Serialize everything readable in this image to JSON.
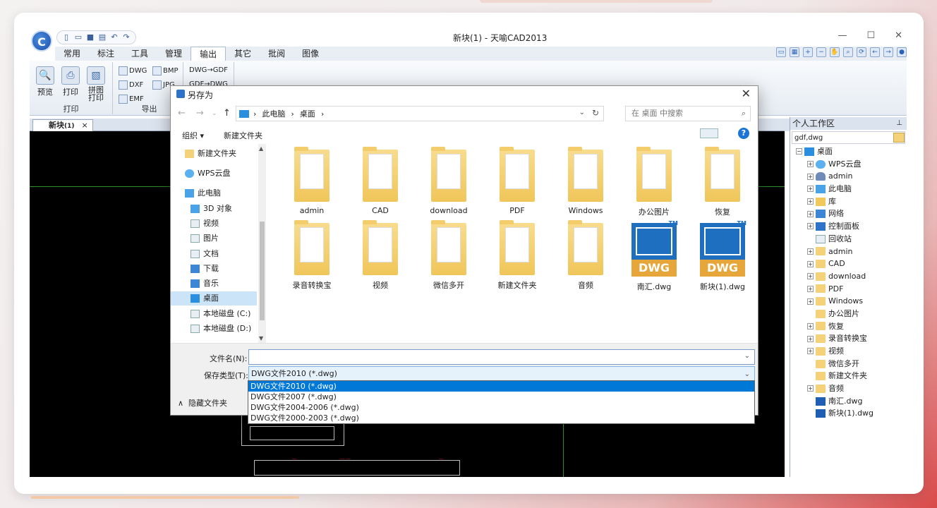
{
  "app": {
    "title": "新块(1) - 天喻CAD2013",
    "logo_letter": "C"
  },
  "menu": [
    "常用",
    "标注",
    "工具",
    "管理",
    "输出",
    "其它",
    "批阅",
    "图像"
  ],
  "active_menu": "输出",
  "ribbon": {
    "print_group": {
      "label": "打印",
      "buttons": [
        "预览",
        "打印",
        "拼图\n打印"
      ]
    },
    "export_group": {
      "label": "导出",
      "items": [
        "DWG",
        "BMP",
        "DXF",
        "JPG",
        "EMF"
      ]
    },
    "convert_group": {
      "items": [
        "DWG→GDF",
        "GDF→DWG"
      ]
    }
  },
  "doc_tab": {
    "name": "新块",
    "suffix": "(1)",
    "close": "×"
  },
  "panel": {
    "title": "个人工作区",
    "pin": "⊥",
    "search": "gdf,dwg",
    "tree": [
      {
        "label": "桌面",
        "icon": "desk",
        "level": 0,
        "expander": "−"
      },
      {
        "label": "WPS云盘",
        "icon": "cloud",
        "level": 1,
        "expander": "+"
      },
      {
        "label": "admin",
        "icon": "user",
        "level": 1,
        "expander": "+"
      },
      {
        "label": "此电脑",
        "icon": "pc",
        "level": 1,
        "expander": "+"
      },
      {
        "label": "库",
        "icon": "lib",
        "level": 1,
        "expander": "+"
      },
      {
        "label": "网络",
        "icon": "net",
        "level": 1,
        "expander": "+"
      },
      {
        "label": "控制面板",
        "icon": "cp",
        "level": 1,
        "expander": "+"
      },
      {
        "label": "回收站",
        "icon": "bin",
        "level": 1,
        "expander": ""
      },
      {
        "label": "admin",
        "icon": "f",
        "level": 1,
        "expander": "+"
      },
      {
        "label": "CAD",
        "icon": "f",
        "level": 1,
        "expander": "+"
      },
      {
        "label": "download",
        "icon": "f",
        "level": 1,
        "expander": "+"
      },
      {
        "label": "PDF",
        "icon": "f",
        "level": 1,
        "expander": "+"
      },
      {
        "label": "Windows",
        "icon": "f",
        "level": 1,
        "expander": "+"
      },
      {
        "label": "办公图片",
        "icon": "f",
        "level": 1,
        "expander": ""
      },
      {
        "label": "恢复",
        "icon": "f",
        "level": 1,
        "expander": "+"
      },
      {
        "label": "录音转换宝",
        "icon": "f",
        "level": 1,
        "expander": "+"
      },
      {
        "label": "视频",
        "icon": "f",
        "level": 1,
        "expander": "+"
      },
      {
        "label": "微信多开",
        "icon": "f",
        "level": 1,
        "expander": ""
      },
      {
        "label": "新建文件夹",
        "icon": "f",
        "level": 1,
        "expander": ""
      },
      {
        "label": "音频",
        "icon": "f",
        "level": 1,
        "expander": "+"
      },
      {
        "label": "南汇.dwg",
        "icon": "dwgi",
        "level": 1,
        "expander": ""
      },
      {
        "label": "新块(1).dwg",
        "icon": "dwgi",
        "level": 1,
        "expander": ""
      }
    ]
  },
  "dialog": {
    "title": "另存为",
    "close": "✕",
    "breadcrumb": [
      "此电脑",
      "桌面"
    ],
    "search_placeholder": "在 桌面 中搜索",
    "organize": "组织 ▾",
    "new_folder": "新建文件夹",
    "help": "?",
    "nav_items": [
      {
        "label": "新建文件夹",
        "icon": "f"
      },
      {
        "label": "WPS云盘",
        "icon": "cloud"
      },
      {
        "label": "此电脑",
        "icon": "pc"
      },
      {
        "label": "3D 对象",
        "icon": "pc"
      },
      {
        "label": "视频",
        "icon": "bin"
      },
      {
        "label": "图片",
        "icon": "bin"
      },
      {
        "label": "文档",
        "icon": "bin"
      },
      {
        "label": "下载",
        "icon": "net"
      },
      {
        "label": "音乐",
        "icon": "net"
      },
      {
        "label": "桌面",
        "icon": "desk"
      },
      {
        "label": "本地磁盘 (C:)",
        "icon": "bin"
      },
      {
        "label": "本地磁盘 (D:)",
        "icon": "bin"
      }
    ],
    "selected_nav": "桌面",
    "files": [
      {
        "name": "admin",
        "type": "folder"
      },
      {
        "name": "CAD",
        "type": "folder"
      },
      {
        "name": "download",
        "type": "folder"
      },
      {
        "name": "PDF",
        "type": "folder"
      },
      {
        "name": "Windows",
        "type": "folder"
      },
      {
        "name": "办公图片",
        "type": "folder"
      },
      {
        "name": "恢复",
        "type": "folder"
      },
      {
        "name": "录音转换宝",
        "type": "folder"
      },
      {
        "name": "视频",
        "type": "folder"
      },
      {
        "name": "微信多开",
        "type": "folder"
      },
      {
        "name": "新建文件夹",
        "type": "folder"
      },
      {
        "name": "音频",
        "type": "folder"
      },
      {
        "name": "南汇.dwg",
        "type": "dwg"
      },
      {
        "name": "新块(1).dwg",
        "type": "dwg"
      }
    ],
    "dwg_label": "DWG",
    "dwg_tm": "TM",
    "filename_label": "文件名(N):",
    "filename_value": "",
    "filetype_label": "保存类型(T):",
    "filetype_value": "DWG文件2010 (*.dwg)",
    "filetype_options": [
      "DWG文件2010 (*.dwg)",
      "DWG文件2007 (*.dwg)",
      "DWG文件2004-2006 (*.dwg)",
      "DWG文件2000-2003 (*.dwg)"
    ],
    "hide_folders": "隐藏文件夹"
  }
}
